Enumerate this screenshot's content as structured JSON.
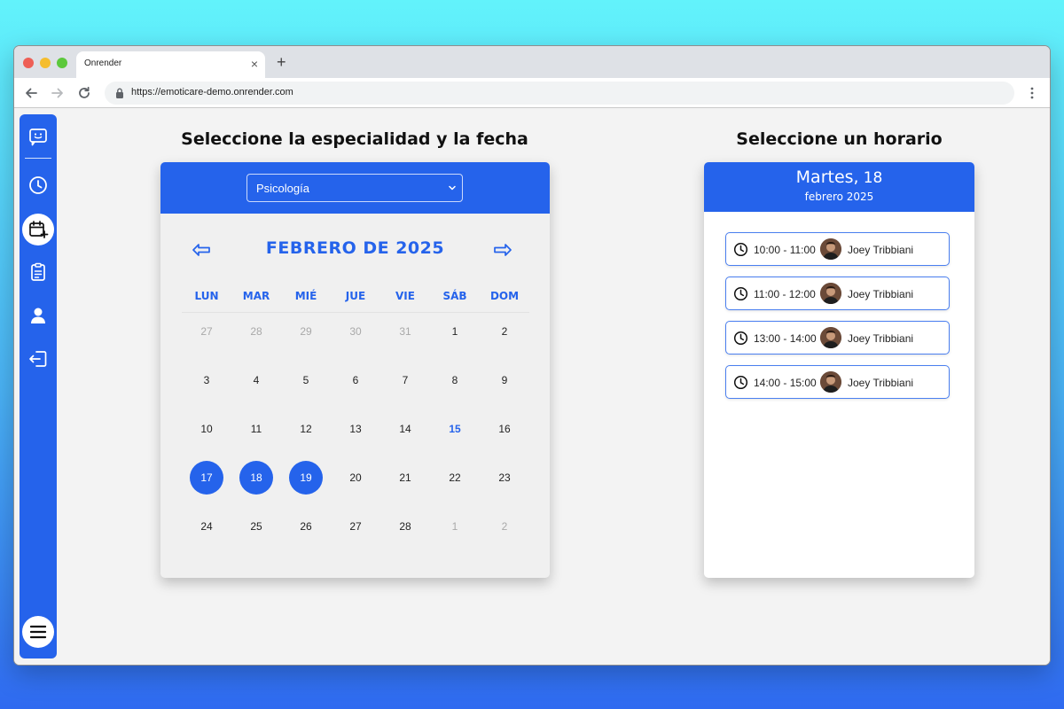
{
  "browser": {
    "tab_title": "Onrender",
    "tab_close": "×",
    "new_tab": "+",
    "url": "https://emoticare-demo.onrender.com"
  },
  "sidebar": {
    "icons": [
      "chat-face-icon",
      "clock-icon",
      "calendar-add-icon",
      "clipboard-icon",
      "user-icon",
      "logout-icon",
      "hamburger-menu-icon"
    ],
    "active_index": 2
  },
  "calendar_section": {
    "heading": "Seleccione la especialidad y la fecha",
    "specialty_selected": "Psicología",
    "month_title": "FEBRERO DE 2025",
    "weekdays": [
      "LUN",
      "MAR",
      "MIÉ",
      "JUE",
      "VIE",
      "SÁB",
      "DOM"
    ],
    "weeks": [
      [
        {
          "d": "27",
          "s": "muted"
        },
        {
          "d": "28",
          "s": "muted"
        },
        {
          "d": "29",
          "s": "muted"
        },
        {
          "d": "30",
          "s": "muted"
        },
        {
          "d": "31",
          "s": "muted"
        },
        {
          "d": "1",
          "s": ""
        },
        {
          "d": "2",
          "s": ""
        }
      ],
      [
        {
          "d": "3",
          "s": ""
        },
        {
          "d": "4",
          "s": ""
        },
        {
          "d": "5",
          "s": ""
        },
        {
          "d": "6",
          "s": ""
        },
        {
          "d": "7",
          "s": ""
        },
        {
          "d": "8",
          "s": ""
        },
        {
          "d": "9",
          "s": ""
        }
      ],
      [
        {
          "d": "10",
          "s": ""
        },
        {
          "d": "11",
          "s": ""
        },
        {
          "d": "12",
          "s": ""
        },
        {
          "d": "13",
          "s": ""
        },
        {
          "d": "14",
          "s": ""
        },
        {
          "d": "15",
          "s": "today"
        },
        {
          "d": "16",
          "s": ""
        }
      ],
      [
        {
          "d": "17",
          "s": "selected"
        },
        {
          "d": "18",
          "s": "selected"
        },
        {
          "d": "19",
          "s": "selected"
        },
        {
          "d": "20",
          "s": ""
        },
        {
          "d": "21",
          "s": ""
        },
        {
          "d": "22",
          "s": ""
        },
        {
          "d": "23",
          "s": ""
        }
      ],
      [
        {
          "d": "24",
          "s": ""
        },
        {
          "d": "25",
          "s": ""
        },
        {
          "d": "26",
          "s": ""
        },
        {
          "d": "27",
          "s": ""
        },
        {
          "d": "28",
          "s": ""
        },
        {
          "d": "1",
          "s": "muted"
        },
        {
          "d": "2",
          "s": "muted"
        }
      ]
    ]
  },
  "schedule_section": {
    "heading": "Seleccione un horario",
    "weekday": "Martes,",
    "day_number": "18",
    "month_year": "febrero 2025",
    "slots": [
      {
        "time": "10:00 - 11:00",
        "doctor": "Joey Tribbiani"
      },
      {
        "time": "11:00 - 12:00",
        "doctor": "Joey Tribbiani"
      },
      {
        "time": "13:00 - 14:00",
        "doctor": "Joey Tribbiani"
      },
      {
        "time": "14:00 - 15:00",
        "doctor": "Joey Tribbiani"
      }
    ]
  },
  "colors": {
    "accent": "#2563eb",
    "muted_day": "#a9a9a9",
    "page_bg": "#f3f3f3"
  }
}
